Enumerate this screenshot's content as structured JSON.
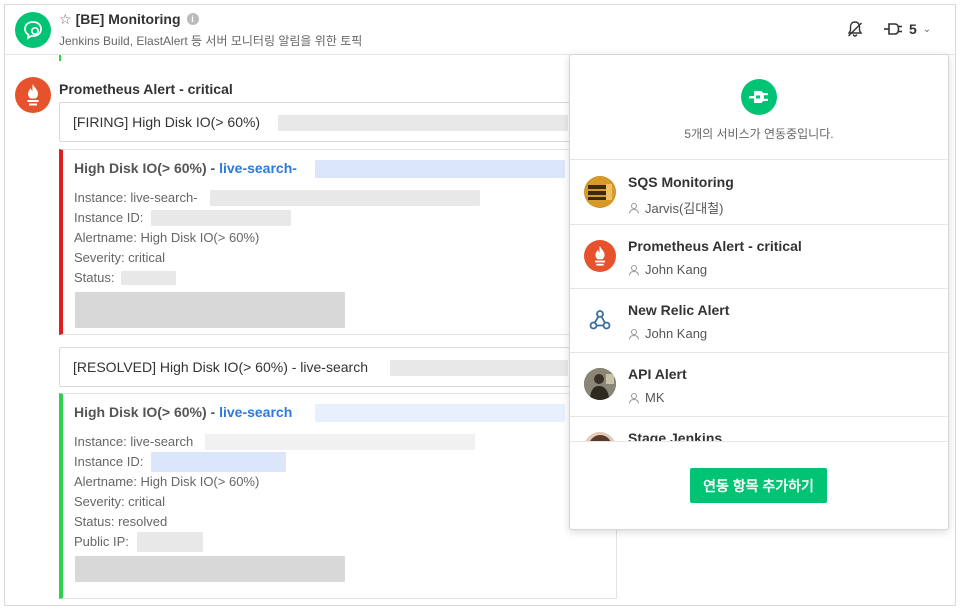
{
  "header": {
    "title": "[BE] Monitoring",
    "subtitle": "Jenkins Build, ElastAlert 등 서버 모니터링 알림을 위한 토픽",
    "integration_count": "5",
    "icons": {
      "topic": "chat-bubble-icon",
      "star": "star-outline-icon",
      "info": "info-icon",
      "bell": "bell-off-icon",
      "plug": "plug-icon",
      "chevron": "chevron-down-icon"
    }
  },
  "message": {
    "sender": "Prometheus Alert - critical",
    "firing": {
      "text": "[FIRING] High Disk IO(> 60%)",
      "title": "High Disk IO(> 60%) - ",
      "title_link": "live-search-",
      "lines": [
        "Instance: live-search-",
        "Instance ID:",
        "Alertname: High Disk IO(> 60%)",
        "Severity: critical",
        "Status:"
      ],
      "accent": "#e01e1e"
    },
    "resolved": {
      "text": "[RESOLVED] High Disk IO(> 60%) - live-search",
      "title": "High Disk IO(> 60%) - ",
      "title_link": "live-search",
      "lines": [
        "Instance: live-search",
        "Instance ID:",
        "Alertname: High Disk IO(> 60%)",
        "Severity: critical",
        "Status: resolved",
        "Public IP:"
      ],
      "accent": "#2fd04a"
    }
  },
  "panel": {
    "summary": "5개의 서비스가 연동중입니다.",
    "services": [
      {
        "name": "SQS Monitoring",
        "owner": "Jarvis(김대철)",
        "icon": "sqs-icon"
      },
      {
        "name": "Prometheus Alert - critical",
        "owner": "John Kang",
        "icon": "prometheus-icon"
      },
      {
        "name": "New Relic Alert",
        "owner": "John Kang",
        "icon": "webhook-icon"
      },
      {
        "name": "API Alert",
        "owner": "MK",
        "icon": "user-photo-icon"
      },
      {
        "name": "Stage Jenkins",
        "owner": "",
        "icon": "jenkins-icon"
      }
    ],
    "add_button": "연동 항목 추가하기"
  },
  "colors": {
    "brand": "#00c473",
    "prometheus": "#e6522c",
    "link": "#2a7ae2"
  }
}
